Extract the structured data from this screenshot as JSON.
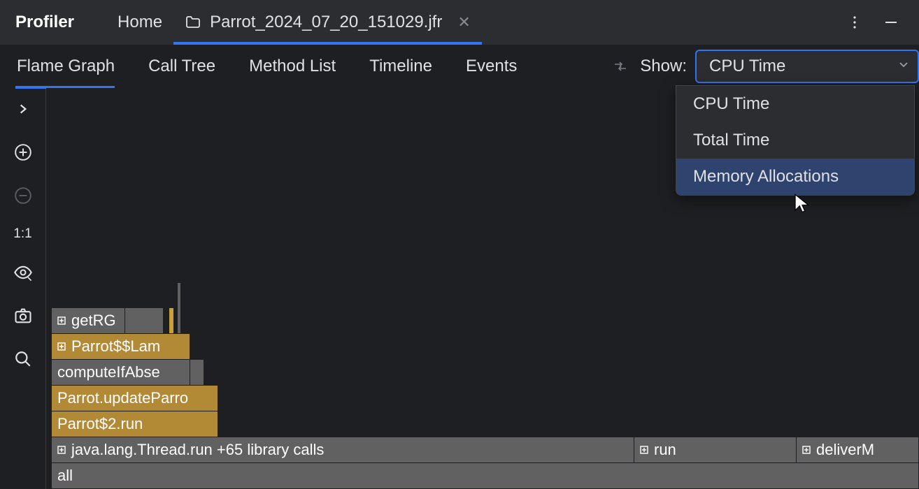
{
  "topbar": {
    "title": "Profiler",
    "home_label": "Home",
    "file_tab": "Parrot_2024_07_20_151029.jfr"
  },
  "subtabs": {
    "flame_graph": "Flame Graph",
    "call_tree": "Call Tree",
    "method_list": "Method List",
    "timeline": "Timeline",
    "events": "Events"
  },
  "show": {
    "label": "Show:",
    "selected": "CPU Time",
    "options": {
      "cpu": "CPU Time",
      "total": "Total Time",
      "memory": "Memory Allocations"
    }
  },
  "side": {
    "ratio": "1:1"
  },
  "flame": {
    "r0": "getRG",
    "r1": "Parrot$$Lam",
    "r2": "computeIfAbse",
    "r3": "Parrot.updateParro",
    "r4": "Parrot$2.run",
    "r5": "java.lang.Thread.run  +65 library calls",
    "r5b": "run",
    "r5c": "deliverM",
    "r6": "all"
  }
}
